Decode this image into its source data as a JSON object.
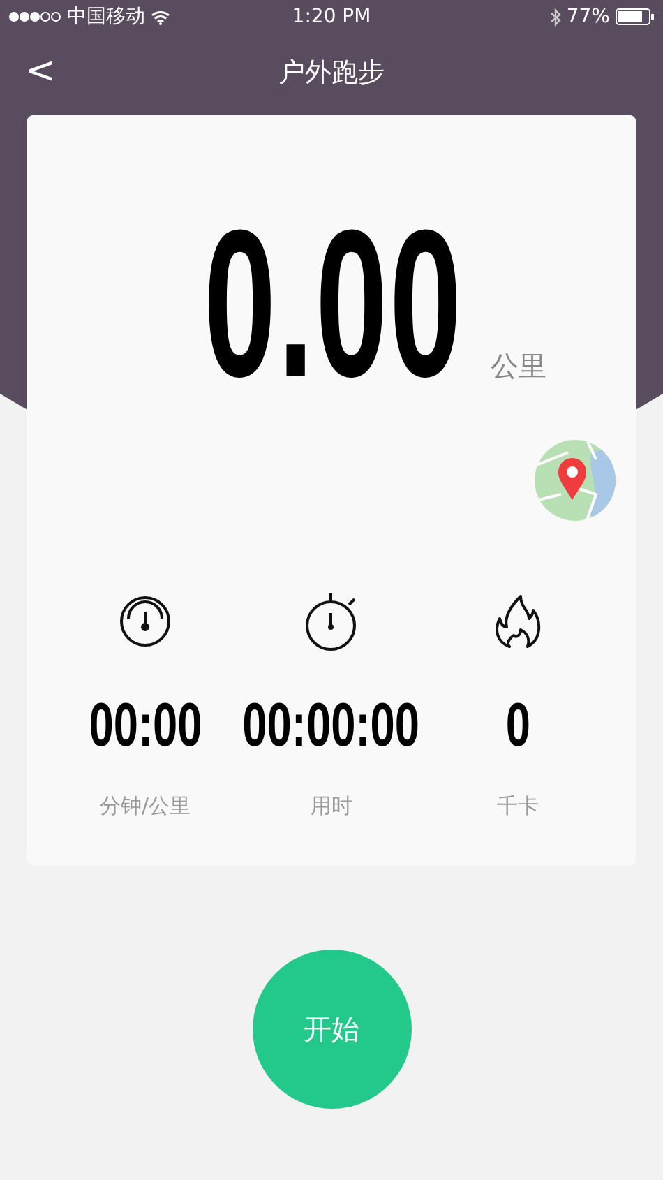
{
  "status_bar": {
    "carrier": "中国移动",
    "time": "1:20 PM",
    "battery": "77%"
  },
  "nav": {
    "back": "<",
    "title": "户外跑步"
  },
  "distance": {
    "value": "0.00",
    "unit": "公里"
  },
  "stats": [
    {
      "kind": "pace",
      "value": "00:00",
      "label": "分钟/公里"
    },
    {
      "kind": "duration",
      "value": "00:00:00",
      "label": "用时"
    },
    {
      "kind": "calories",
      "value": "0",
      "label": "千卡"
    }
  ],
  "start_button": "开始"
}
